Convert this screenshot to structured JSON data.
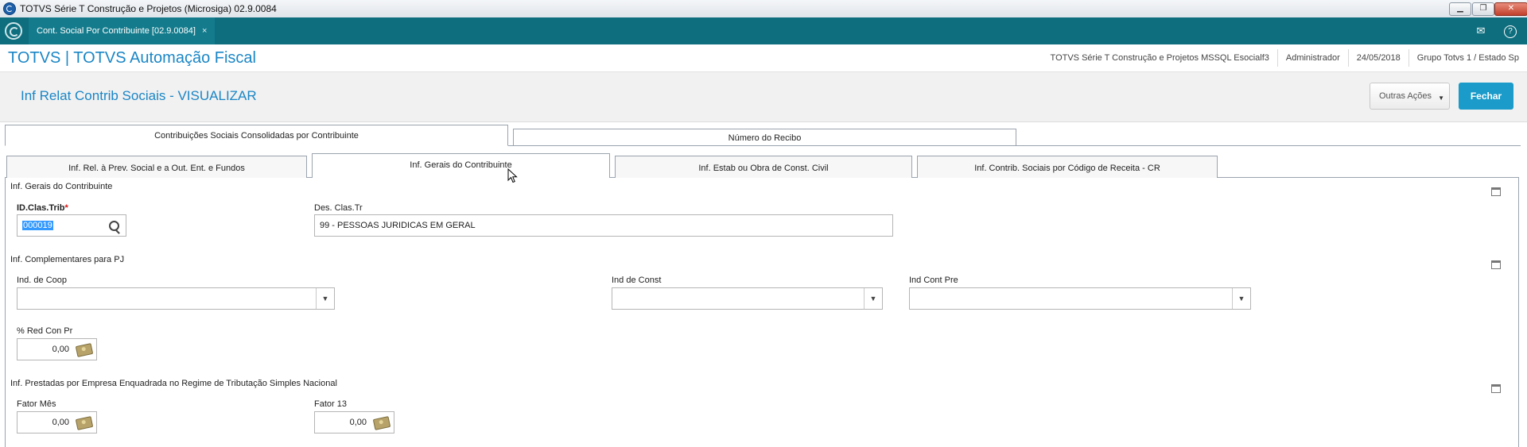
{
  "window": {
    "title": "TOTVS Série T Construção e Projetos (Microsiga) 02.9.0084",
    "controls": {
      "minimize": "▁",
      "maximize": "❐",
      "close": "✕"
    }
  },
  "tabbar": {
    "document_tab": "Cont. Social Por Contribuinte [02.9.0084]",
    "close_glyph": "×",
    "mail_icon": "✉",
    "help_icon": "?"
  },
  "header": {
    "brand": "TOTVS | TOTVS Automação Fiscal",
    "status": [
      "TOTVS Série T Construção e Projetos MSSQL Esocialf3",
      "Administrador",
      "24/05/2018",
      "Grupo Totvs 1 / Estado Sp"
    ]
  },
  "page": {
    "title": "Inf Relat Contrib Sociais - VISUALIZAR",
    "other_actions": "Outras Ações",
    "close_button": "Fechar"
  },
  "upper_tabs": [
    {
      "label": "Contribuições Sociais Consolidadas por Contribuinte",
      "active": true
    },
    {
      "label": "Número do Recibo",
      "active": false
    }
  ],
  "lower_tabs": [
    {
      "label": "Inf. Rel. à Prev. Social e a Out. Ent. e Fundos",
      "active": false
    },
    {
      "label": "Inf. Gerais do Contribuinte",
      "active": true
    },
    {
      "label": "Inf. Estab ou Obra de Const. Civil",
      "active": false
    },
    {
      "label": "Inf. Contrib. Sociais por Código de Receita - CR",
      "active": false
    }
  ],
  "form": {
    "section_general": "Inf. Gerais do Contribuinte",
    "id_clas_trib": {
      "label": "ID.Clas.Trib",
      "required_mark": "*",
      "value": "000019"
    },
    "des_clas_tr": {
      "label": "Des. Clas.Tr",
      "value": "99 - PESSOAS JURIDICAS EM GERAL"
    },
    "section_pj": "Inf. Complementares para PJ",
    "ind_coop": {
      "label": "Ind. de Coop",
      "value": ""
    },
    "ind_const": {
      "label": "Ind de Const",
      "value": ""
    },
    "ind_cont_pre": {
      "label": "Ind Cont Pre",
      "value": ""
    },
    "red_con_pr": {
      "label": "% Red Con Pr",
      "value": "0,00"
    },
    "section_simples": "Inf. Prestadas por Empresa Enquadrada no Regime de Tributação Simples Nacional",
    "fator_mes": {
      "label": "Fator Mês",
      "value": "0,00"
    },
    "fator_13": {
      "label": "Fator 13",
      "value": "0,00"
    },
    "dropdown_glyph": "▼"
  }
}
